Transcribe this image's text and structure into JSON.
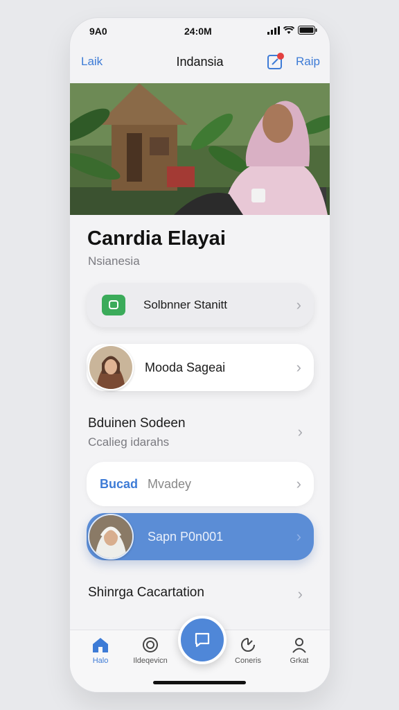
{
  "status_bar": {
    "time_left": "9A0",
    "time_center": "24:0M"
  },
  "nav": {
    "left_label": "Laik",
    "title": "Indansia",
    "right_label": "Raip"
  },
  "profile": {
    "name": "Canrdia Elayai",
    "subtitle": "Nsianesia"
  },
  "rows": {
    "row1": {
      "label": "Solbnner Stanitt",
      "badge_icon": "chat-bubble-icon"
    },
    "row2": {
      "label": "Mooda Sageai"
    },
    "row3": {
      "title": "Bduinen Sodeen",
      "subtitle": "Ccalieg idarahs"
    },
    "row4": {
      "bold_label": "Bucad",
      "label": "Mvadey"
    },
    "row5": {
      "label": "Sapn P0n001"
    },
    "row6": {
      "label": "Shinrga Cacartation"
    }
  },
  "tabbar": {
    "tabs": [
      {
        "label": "Halo",
        "icon": "home-icon",
        "active": true
      },
      {
        "label": "Ildeqevicn",
        "icon": "chat-ring-icon"
      },
      {
        "label": "Coneris",
        "icon": "pie-icon"
      },
      {
        "label": "Grkat",
        "icon": "person-icon"
      }
    ],
    "center_icon": "message-square-icon"
  },
  "colors": {
    "accent": "#3d7bd6",
    "highlight_row": "#5b8dd6",
    "green_badge": "#3bab5a"
  }
}
